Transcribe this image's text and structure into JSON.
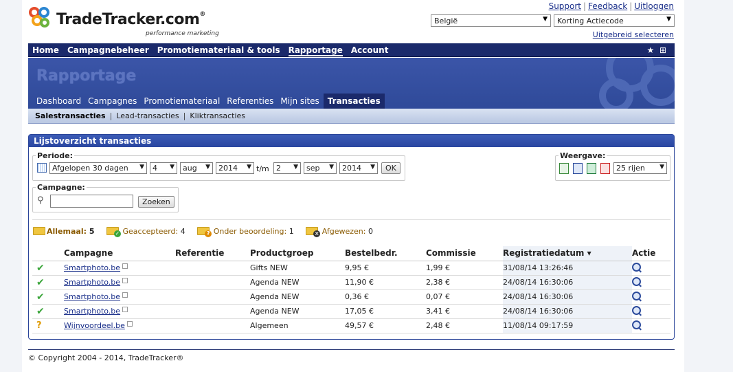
{
  "logo": {
    "brand": "TradeTracker.com",
    "reg": "®",
    "tagline": "performance marketing"
  },
  "toplinks": [
    "Support",
    "Feedback",
    "Uitloggen"
  ],
  "selects": {
    "country": "België",
    "coupon": "Korting Actiecode"
  },
  "advanced_link": "Uitgebreid selecteren",
  "mainnav": [
    "Home",
    "Campagnebeheer",
    "Promotiemateriaal & tools",
    "Rapportage",
    "Account"
  ],
  "banner_title": "Rapportage",
  "subtabs": [
    "Dashboard",
    "Campagnes",
    "Promotiemateriaal",
    "Referenties",
    "Mijn sites",
    "Transacties"
  ],
  "subsubnav": [
    "Salestransacties",
    "Lead-transacties",
    "Kliktransacties"
  ],
  "panel_title": "Lijstoverzicht transacties",
  "periode": {
    "legend": "Periode:",
    "range": "Afgelopen 30 dagen",
    "from_day": "4",
    "from_month": "aug",
    "from_year": "2014",
    "tm": "t/m",
    "to_day": "2",
    "to_month": "sep",
    "to_year": "2014",
    "ok": "OK"
  },
  "weergave": {
    "legend": "Weergave:",
    "rows": "25 rijen"
  },
  "campagne": {
    "legend": "Campagne:",
    "value": "",
    "button": "Zoeken"
  },
  "status": [
    {
      "label": "Allemaal:",
      "count": "5"
    },
    {
      "label": "Geaccepteerd:",
      "count": "4"
    },
    {
      "label": "Onder beoordeling:",
      "count": "1"
    },
    {
      "label": "Afgewezen:",
      "count": "0"
    }
  ],
  "columns": [
    "Campagne",
    "Referentie",
    "Productgroep",
    "Bestelbedr.",
    "Commissie",
    "Registratiedatum",
    "Actie"
  ],
  "sort_indicator": "▾",
  "rows": [
    {
      "status": "ok",
      "campaign": "Smartphoto.be",
      "ref": "",
      "group": "Gifts NEW",
      "amount": "9,95 €",
      "commission": "1,99 €",
      "date": "31/08/14 13:26:46"
    },
    {
      "status": "ok",
      "campaign": "Smartphoto.be",
      "ref": "",
      "group": "Agenda NEW",
      "amount": "11,90 €",
      "commission": "2,38 €",
      "date": "24/08/14 16:30:06"
    },
    {
      "status": "ok",
      "campaign": "Smartphoto.be",
      "ref": "",
      "group": "Agenda NEW",
      "amount": "0,36 €",
      "commission": "0,07 €",
      "date": "24/08/14 16:30:06"
    },
    {
      "status": "ok",
      "campaign": "Smartphoto.be",
      "ref": "",
      "group": "Agenda NEW",
      "amount": "17,05 €",
      "commission": "3,41 €",
      "date": "24/08/14 16:30:06"
    },
    {
      "status": "pending",
      "campaign": "Wijnvoordeel.be",
      "ref": "",
      "group": "Algemeen",
      "amount": "49,57 €",
      "commission": "2,48 €",
      "date": "11/08/14 09:17:59"
    }
  ],
  "footer": "© Copyright 2004 - 2014, TradeTracker®"
}
